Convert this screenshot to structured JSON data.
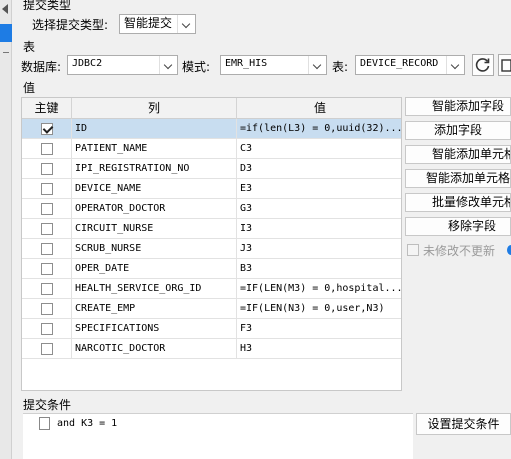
{
  "commit_type": {
    "section_title": "提交类型",
    "label": "选择提交类型:",
    "selected": "智能提交"
  },
  "table_section": {
    "section_title": "表",
    "database_label": "数据库:",
    "database_value": "JDBC2",
    "schema_label": "模式:",
    "schema_value": "EMR_HIS",
    "table_label": "表:",
    "table_value": "DEVICE_RECORD",
    "icons": [
      "refresh-icon",
      "edit-icon"
    ]
  },
  "values_section": {
    "section_title": "值",
    "columns": [
      "主键",
      "列",
      "值"
    ],
    "rows": [
      {
        "key": true,
        "column": "ID",
        "value": "=if(len(L3) = 0,uuid(32)..."
      },
      {
        "key": false,
        "column": "PATIENT_NAME",
        "value": "C3"
      },
      {
        "key": false,
        "column": "IPI_REGISTRATION_NO",
        "value": "D3"
      },
      {
        "key": false,
        "column": "DEVICE_NAME",
        "value": "E3"
      },
      {
        "key": false,
        "column": "OPERATOR_DOCTOR",
        "value": "G3"
      },
      {
        "key": false,
        "column": "CIRCUIT_NURSE",
        "value": "I3"
      },
      {
        "key": false,
        "column": "SCRUB_NURSE",
        "value": "J3"
      },
      {
        "key": false,
        "column": "OPER_DATE",
        "value": "B3"
      },
      {
        "key": false,
        "column": "HEALTH_SERVICE_ORG_ID",
        "value": "=IF(LEN(M3) = 0,hospital..."
      },
      {
        "key": false,
        "column": "CREATE_EMP",
        "value": "=IF(LEN(N3) = 0,user,N3)"
      },
      {
        "key": false,
        "column": "SPECIFICATIONS",
        "value": "F3"
      },
      {
        "key": false,
        "column": "NARCOTIC_DOCTOR",
        "value": "H3"
      }
    ],
    "selected_row": 0
  },
  "side_buttons": {
    "smart_add_field": "智能添加字段",
    "add_field": "添加字段",
    "smart_add_cell_1": "智能添加单元格",
    "smart_add_cell_2": "智能添加单元格组",
    "batch_edit_cell": "批量修改单元格",
    "remove_field": "移除字段",
    "no_update_unchanged": "未修改不更新"
  },
  "commit_condition": {
    "section_title": "提交条件",
    "condition_text": "and K3 = 1",
    "set_button": "设置提交条件"
  },
  "colors": {
    "selection": "#c8ddf0",
    "accent": "#1e7ce4"
  }
}
